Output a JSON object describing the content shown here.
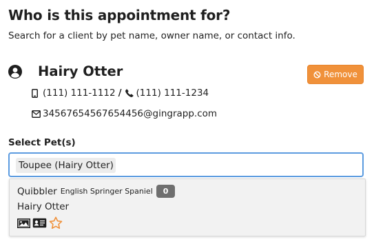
{
  "header": {
    "title": "Who is this appointment for?",
    "subtitle": "Search for a client by pet name, owner name, or contact info."
  },
  "client": {
    "name": "Hairy Otter",
    "mobile_phone": "(111) 111-1112",
    "separator": "/",
    "phone": "(111) 111-1234",
    "email": "34567654567654456@gingrapp.com",
    "remove_label": "Remove",
    "remove_color": "#f0913a"
  },
  "pet_select": {
    "label": "Select Pet(s)",
    "selected": [
      "Toupee (Hairy Otter)"
    ],
    "focus_border_color": "#5b9be0"
  },
  "dropdown": {
    "options": [
      {
        "pet_name": "Quibbler",
        "breed": "English Springer Spaniel",
        "count": "0",
        "owner": "Hairy Otter",
        "icons": [
          "image-icon",
          "id-card-icon",
          "star-outline-icon"
        ]
      }
    ]
  }
}
